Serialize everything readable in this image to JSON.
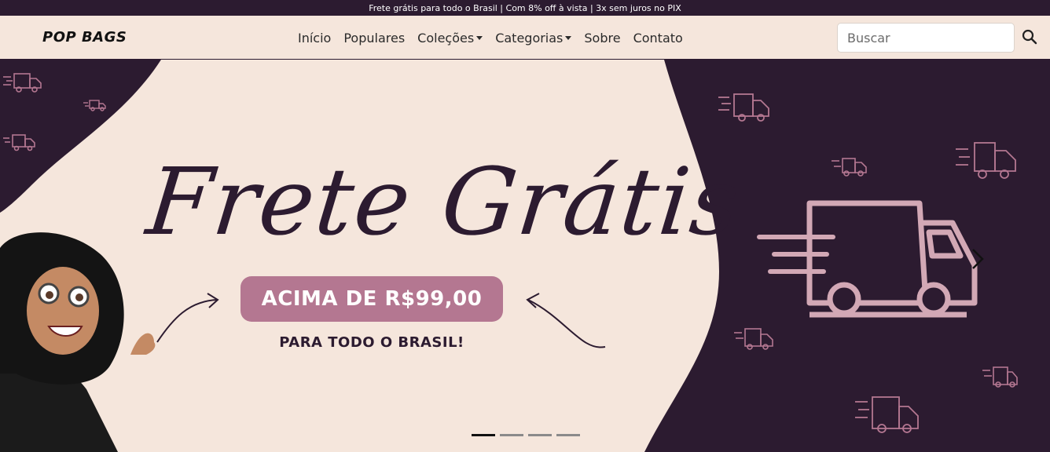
{
  "topbar": {
    "text": "Frete grátis para todo o Brasil | Com 8% off à vista | 3x sem juros no PIX"
  },
  "navbar": {
    "brand": "POP BAGS",
    "links": [
      {
        "label": "Início"
      },
      {
        "label": "Populares"
      },
      {
        "label": "Coleções"
      },
      {
        "label": "Categorias"
      },
      {
        "label": "Sobre"
      },
      {
        "label": "Contato"
      }
    ],
    "search": {
      "placeholder": "Buscar",
      "value": ""
    }
  },
  "banner": {
    "title": "Frete Grátis",
    "pill": "ACIMA DE R$99,00",
    "subtitle": "PARA TODO O BRASIL!"
  },
  "carousel": {
    "slides": 4,
    "active_slide": 1
  },
  "colors": {
    "dark": "#2c1b30",
    "cream": "#f5e6dc",
    "pink": "#b47791",
    "truck": "#d2a8b5"
  },
  "icons": [
    "truck-icon",
    "search-icon",
    "chevron-right-icon",
    "caret-down-icon",
    "arrow-icon"
  ]
}
